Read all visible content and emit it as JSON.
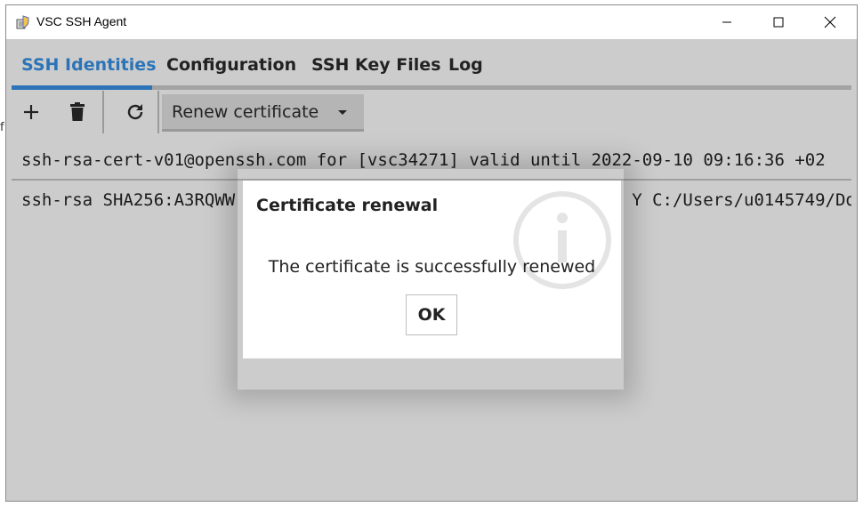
{
  "window": {
    "title": "VSC SSH Agent",
    "icon": "app-shield-icon",
    "controls": [
      "minimize-icon",
      "maximize-icon",
      "close-icon"
    ]
  },
  "stray_text": "f",
  "tabs": [
    {
      "label": "SSH Identities",
      "active": true
    },
    {
      "label": "Configuration",
      "active": false
    },
    {
      "label": "SSH Key Files",
      "active": false
    },
    {
      "label": "Log",
      "active": false
    }
  ],
  "toolbar": {
    "add_icon": "plus-icon",
    "delete_icon": "trash-icon",
    "refresh_icon": "refresh-icon",
    "renew_label": "Renew certificate",
    "renew_caret_icon": "caret-down-icon"
  },
  "identities": [
    "ssh-rsa-cert-v01@openssh.com for [vsc34271] valid until 2022-09-10 09:16:36 +02",
    "ssh-rsa SHA256:A3RQWW",
    "Y C:/Users/u0145749/Do"
  ],
  "dialog": {
    "title": "Certificate renewal",
    "message": "The certificate is successfully renewed",
    "ok_label": "OK",
    "icon": "info-icon"
  },
  "colors": {
    "accent": "#2c74b7",
    "client_background": "#cccccc",
    "dialog_background": "#ffffff"
  }
}
